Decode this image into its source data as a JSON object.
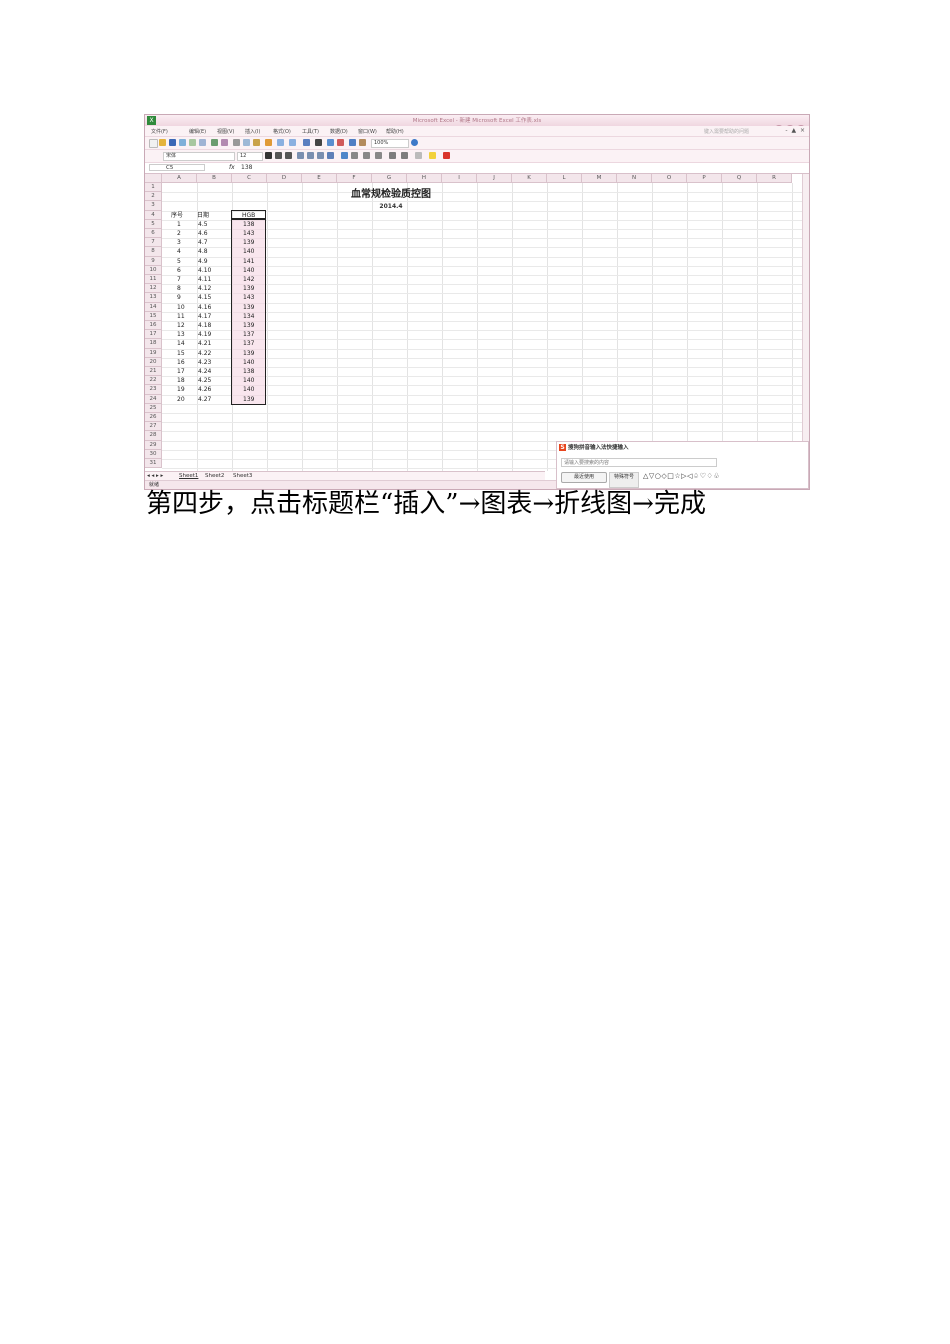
{
  "window": {
    "app_icon": "X",
    "title": "Microsoft Excel - 新建 Microsoft Excel 工作表.xls",
    "minimize": "–",
    "maximize": "□",
    "close": "×"
  },
  "menu": {
    "items": [
      "文件(F)",
      "编辑(E)",
      "视图(V)",
      "插入(I)",
      "格式(O)",
      "工具(T)",
      "数据(D)",
      "窗口(W)",
      "帮助(H)"
    ],
    "help_placeholder": "键入需要帮助的问题",
    "doc_controls": "- ▲ ×"
  },
  "toolbar": {
    "zoom": "100%",
    "font_name": "宋体",
    "font_size": "12"
  },
  "formula_bar": {
    "name_box": "C5",
    "fx": "fx",
    "value": "138"
  },
  "columns": [
    "A",
    "B",
    "C",
    "D",
    "E",
    "F",
    "G",
    "H",
    "I",
    "J",
    "K",
    "L",
    "M",
    "N",
    "O",
    "P",
    "Q",
    "R"
  ],
  "rows": [
    "1",
    "2",
    "3",
    "4",
    "5",
    "6",
    "7",
    "8",
    "9",
    "10",
    "11",
    "12",
    "13",
    "14",
    "15",
    "16",
    "17",
    "18",
    "19",
    "20",
    "21",
    "22",
    "23",
    "24",
    "25",
    "26",
    "27",
    "28",
    "29",
    "30",
    "31"
  ],
  "sheet": {
    "title": "血常规检验质控图",
    "date": "2014.4",
    "headers": {
      "seq": "序号",
      "date": "日期",
      "value": "HGB"
    },
    "data": [
      {
        "seq": "1",
        "date": "4.5",
        "value": "138"
      },
      {
        "seq": "2",
        "date": "4.6",
        "value": "143"
      },
      {
        "seq": "3",
        "date": "4.7",
        "value": "139"
      },
      {
        "seq": "4",
        "date": "4.8",
        "value": "140"
      },
      {
        "seq": "5",
        "date": "4.9",
        "value": "141"
      },
      {
        "seq": "6",
        "date": "4.10",
        "value": "140"
      },
      {
        "seq": "7",
        "date": "4.11",
        "value": "142"
      },
      {
        "seq": "8",
        "date": "4.12",
        "value": "139"
      },
      {
        "seq": "9",
        "date": "4.15",
        "value": "143"
      },
      {
        "seq": "10",
        "date": "4.16",
        "value": "139"
      },
      {
        "seq": "11",
        "date": "4.17",
        "value": "134"
      },
      {
        "seq": "12",
        "date": "4.18",
        "value": "139"
      },
      {
        "seq": "13",
        "date": "4.19",
        "value": "137"
      },
      {
        "seq": "14",
        "date": "4.21",
        "value": "137"
      },
      {
        "seq": "15",
        "date": "4.22",
        "value": "139"
      },
      {
        "seq": "16",
        "date": "4.23",
        "value": "140"
      },
      {
        "seq": "17",
        "date": "4.24",
        "value": "138"
      },
      {
        "seq": "18",
        "date": "4.25",
        "value": "140"
      },
      {
        "seq": "19",
        "date": "4.26",
        "value": "140"
      },
      {
        "seq": "20",
        "date": "4.27",
        "value": "139"
      }
    ]
  },
  "tabs": {
    "nav": "◂ ◂ ▸ ▸",
    "items": [
      "Sheet1",
      "Sheet2",
      "Sheet3"
    ]
  },
  "status": {
    "text": "就绪"
  },
  "ime": {
    "logo": "S",
    "title": "搜狗拼音输入法快捷输入",
    "search_placeholder": "请输入要搜索的内容",
    "recent_button": "最近使用",
    "tab_label": "特殊符号",
    "symbols": "△▽○◇□☆▷◁♤♡♢♧"
  },
  "caption": "第四步，点击标题栏“插入”→图表→折线图→完成"
}
